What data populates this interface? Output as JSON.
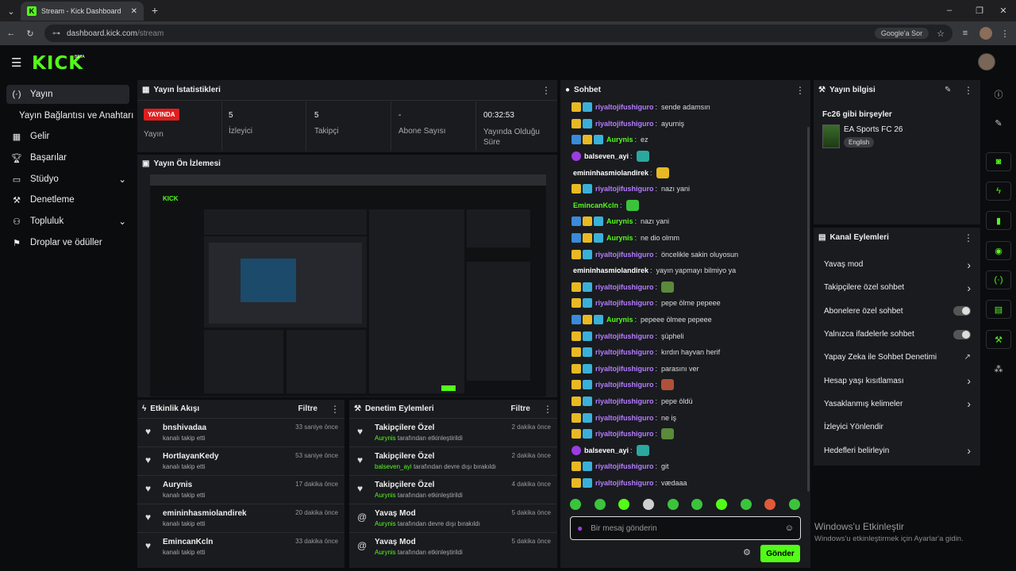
{
  "browser": {
    "tab_title": "Stream - Kick Dashboard",
    "url_domain": "dashboard.kick.com",
    "url_path": "/stream",
    "google_lens_label": "Google'a Sor"
  },
  "logo": {
    "text": "KICK",
    "beta": "BETA"
  },
  "sidebar": {
    "items": [
      {
        "label": "Yayın",
        "icon": "broadcast-icon",
        "active": true
      },
      {
        "label": "Yayın Bağlantısı ve Anahtarı"
      },
      {
        "label": "Gelir",
        "icon": "chart-icon"
      },
      {
        "label": "Başarılar",
        "icon": "trophy-icon"
      },
      {
        "label": "Stüdyo",
        "icon": "studio-icon",
        "expandable": true
      },
      {
        "label": "Denetleme",
        "icon": "wrench-icon"
      },
      {
        "label": "Topluluk",
        "icon": "community-icon",
        "expandable": true
      },
      {
        "label": "Droplar ve ödüller",
        "icon": "gift-icon"
      }
    ]
  },
  "stats": {
    "title": "Yayın İstatistikleri",
    "live_label": "YAYINDA",
    "live_sub": "Yayın",
    "viewers_value": "5",
    "viewers_label": "İzleyici",
    "followers_value": "5",
    "followers_label": "Takipçi",
    "subs_value": "-",
    "subs_label": "Abone Sayısı",
    "duration_value": "00:32:53",
    "duration_label": "Yayında Olduğu Süre"
  },
  "preview": {
    "title": "Yayın Ön İzlemesi"
  },
  "activity": {
    "title": "Etkinlik Akışı",
    "filter": "Filtre",
    "items": [
      {
        "name": "bnshivadaa",
        "sub": "kanalı takip etti",
        "time": "33 saniye önce"
      },
      {
        "name": "HortlayanKedy",
        "sub": "kanalı takip etti",
        "time": "53 saniye önce"
      },
      {
        "name": "Aurynis",
        "sub": "kanalı takip etti",
        "time": "17 dakika önce"
      },
      {
        "name": "emininhasmiolandirek",
        "sub": "kanalı takip etti",
        "time": "20 dakika önce"
      },
      {
        "name": "EmincanKcln",
        "sub": "kanalı takip etti",
        "time": "33 dakika önce"
      }
    ]
  },
  "moderation": {
    "title": "Denetim Eylemleri",
    "filter": "Filtre",
    "items": [
      {
        "name": "Takipçilere Özel",
        "user": "Aurynis",
        "sub": "tarafından etkinleştirildi",
        "time": "2 dakika önce"
      },
      {
        "name": "Takipçilere Özel",
        "user": "balseven_ayi",
        "sub": "tarafından devre dışı bırakıldı",
        "time": "2 dakika önce"
      },
      {
        "name": "Takipçilere Özel",
        "user": "Aurynis",
        "sub": "tarafından etkinleştirildi",
        "time": "4 dakika önce"
      },
      {
        "name": "Yavaş Mod",
        "user": "Aurynis",
        "sub": "tarafından devre dışı bırakıldı",
        "time": "5 dakika önce"
      },
      {
        "name": "Yavaş Mod",
        "user": "Aurynis",
        "sub": "tarafından etkinleştirildi",
        "time": "5 dakika önce"
      }
    ]
  },
  "chat": {
    "title": "Sohbet",
    "placeholder": "Bir mesaj gönderin",
    "send": "Gönder",
    "messages": [
      {
        "user": "riyaltojifushiguro",
        "text": "sende adamsın",
        "color": "#b57bff",
        "badges": [
          "gold",
          "teal"
        ]
      },
      {
        "user": "riyaltojifushiguro",
        "text": "ayurniş",
        "color": "#b57bff",
        "badges": [
          "gold",
          "teal"
        ]
      },
      {
        "user": "Aurynis",
        "text": "ez",
        "color": "#53fc18",
        "badges": [
          "blue",
          "gold",
          "teal"
        ]
      },
      {
        "user": "balseven_ayi",
        "text": "",
        "color": "#ffffff",
        "badges": [
          "purple"
        ],
        "emote": "#2aa8a0"
      },
      {
        "user": "emininhasmiolandirek",
        "text": "",
        "color": "#ffffff",
        "badges": [],
        "emote": "#e8b923"
      },
      {
        "user": "riyaltojifushiguro",
        "text": "nazı yani",
        "color": "#b57bff",
        "badges": [
          "gold",
          "teal"
        ]
      },
      {
        "user": "EmincanKcln",
        "text": "",
        "color": "#53fc18",
        "badges": [],
        "emote": "#3cc33c"
      },
      {
        "user": "Aurynis",
        "text": "nazı yani",
        "color": "#53fc18",
        "badges": [
          "blue",
          "gold",
          "teal"
        ]
      },
      {
        "user": "Aurynis",
        "text": "ne dio olmm",
        "color": "#53fc18",
        "badges": [
          "blue",
          "gold",
          "teal"
        ]
      },
      {
        "user": "riyaltojifushiguro",
        "text": "öncelikle sakin oluyosun",
        "color": "#b57bff",
        "badges": [
          "gold",
          "teal"
        ]
      },
      {
        "user": "emininhasmiolandirek",
        "text": "yayın yapmayı bilmiyo ya",
        "color": "#ffffff",
        "badges": []
      },
      {
        "user": "riyaltojifushiguro",
        "text": "",
        "color": "#b57bff",
        "badges": [
          "gold",
          "teal"
        ],
        "emote": "#5a8a3a"
      },
      {
        "user": "riyaltojifushiguro",
        "text": "pepe ölme pepeee",
        "color": "#b57bff",
        "badges": [
          "gold",
          "teal"
        ]
      },
      {
        "user": "Aurynis",
        "text": "pepeee ölmee pepeee",
        "color": "#53fc18",
        "badges": [
          "blue",
          "gold",
          "teal"
        ]
      },
      {
        "user": "riyaltojifushiguro",
        "text": "şüpheli",
        "color": "#b57bff",
        "badges": [
          "gold",
          "teal"
        ]
      },
      {
        "user": "riyaltojifushiguro",
        "text": "kırdın hayvan herif",
        "color": "#b57bff",
        "badges": [
          "gold",
          "teal"
        ]
      },
      {
        "user": "riyaltojifushiguro",
        "text": "parasını ver",
        "color": "#b57bff",
        "badges": [
          "gold",
          "teal"
        ]
      },
      {
        "user": "riyaltojifushiguro",
        "text": "",
        "color": "#b57bff",
        "badges": [
          "gold",
          "teal"
        ],
        "emote": "#b0503a"
      },
      {
        "user": "riyaltojifushiguro",
        "text": "pepe öldü",
        "color": "#b57bff",
        "badges": [
          "gold",
          "teal"
        ]
      },
      {
        "user": "riyaltojifushiguro",
        "text": "ne iş",
        "color": "#b57bff",
        "badges": [
          "gold",
          "teal"
        ]
      },
      {
        "user": "riyaltojifushiguro",
        "text": "",
        "color": "#b57bff",
        "badges": [
          "gold",
          "teal"
        ],
        "emote": "#5a8a3a"
      },
      {
        "user": "balseven_ayi",
        "text": "",
        "color": "#ffffff",
        "badges": [
          "purple"
        ],
        "emote": "#2aa8a0"
      },
      {
        "user": "riyaltojifushiguro",
        "text": "git",
        "color": "#b57bff",
        "badges": [
          "gold",
          "teal"
        ]
      },
      {
        "user": "riyaltojifushiguro",
        "text": "vædaaa",
        "color": "#b57bff",
        "badges": [
          "gold",
          "teal"
        ]
      }
    ],
    "emote_bar": [
      "#3cc33c",
      "#3cc33c",
      "#53fc18",
      "#cfcfcf",
      "#3cc33c",
      "#3cc33c",
      "#53fc18",
      "#3cc33c",
      "#e05a3a",
      "#3cc33c"
    ]
  },
  "info": {
    "title": "Yayın bilgisi",
    "stream_title": "Fc26 gibi birşeyler",
    "category": "EA Sports FC 26",
    "language": "English"
  },
  "channel_actions": {
    "title": "Kanal Eylemleri",
    "items": [
      {
        "label": "Yavaş mod",
        "control": "chevron"
      },
      {
        "label": "Takipçilere özel sohbet",
        "control": "chevron"
      },
      {
        "label": "Abonelere özel sohbet",
        "control": "toggle"
      },
      {
        "label": "Yalnızca ifadelerle sohbet",
        "control": "toggle"
      },
      {
        "label": "Yapay Zeka ile Sohbet Denetimi",
        "control": "external"
      },
      {
        "label": "Hesap yaşı kısıtlaması",
        "control": "chevron"
      },
      {
        "label": "Yasaklanmış kelimeler",
        "control": "chevron"
      },
      {
        "label": "İzleyici Yönlendir",
        "control": "none"
      },
      {
        "label": "Hedefleri belirleyin",
        "control": "chevron"
      }
    ]
  },
  "watermark": {
    "line1": "Windows'u Etkinleştir",
    "line2": "Windows'u etkinleştirmek için Ayarlar'a gidin."
  },
  "colors": {
    "accent": "#53fc18",
    "live": "#e01e1e",
    "panel": "#191b1f",
    "background": "#0b0c0e"
  }
}
